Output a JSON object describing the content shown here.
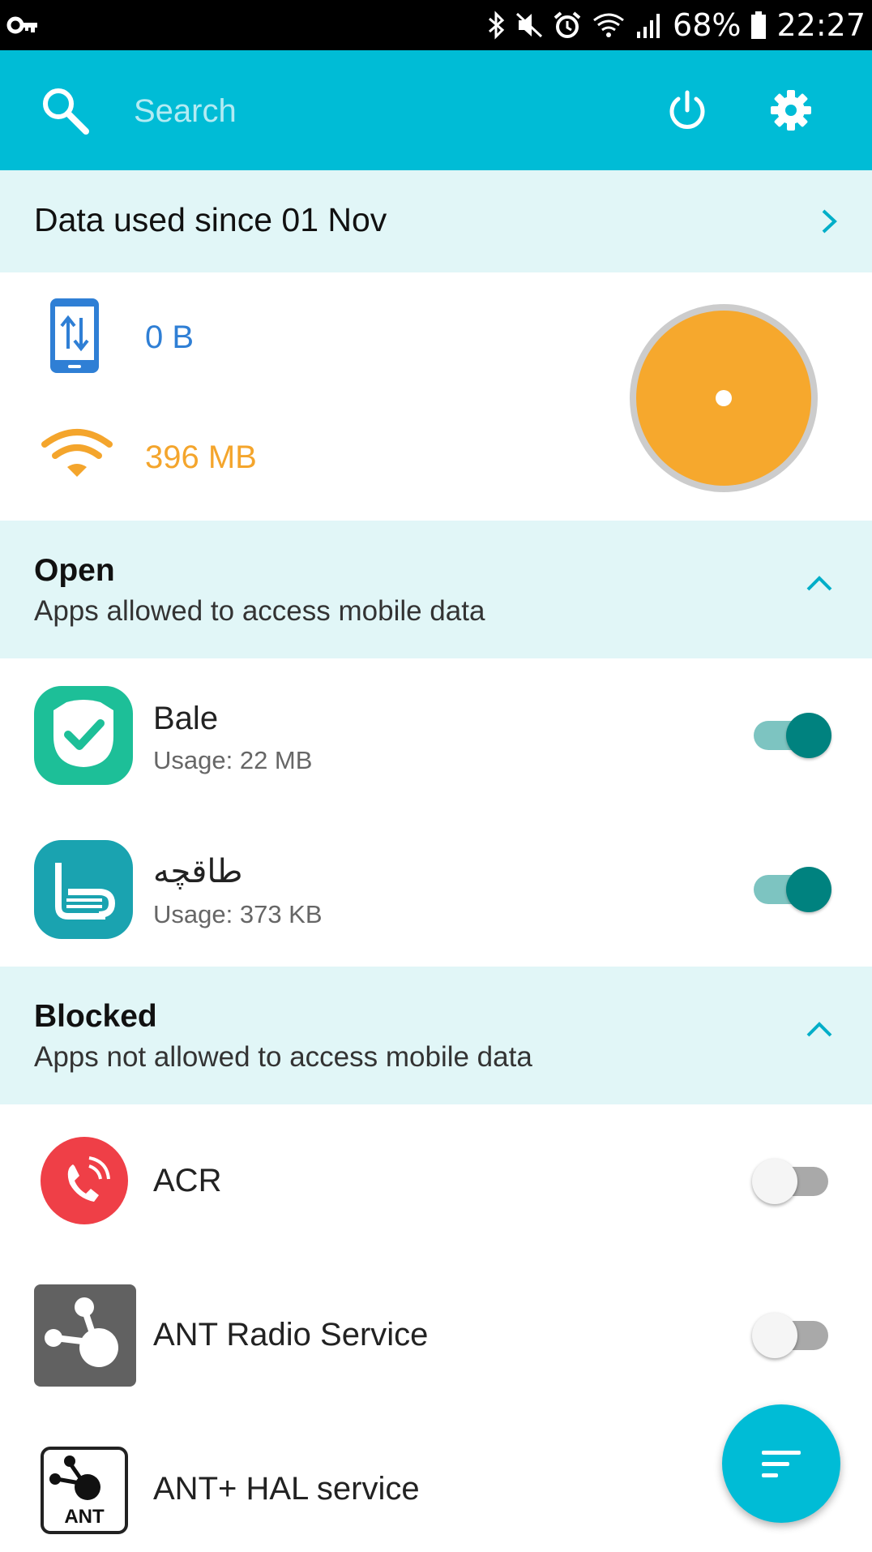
{
  "status_bar": {
    "battery": "68%",
    "time": "22:27",
    "icons": [
      "vpn-key-icon",
      "bluetooth-icon",
      "mute-icon",
      "alarm-icon",
      "wifi-icon",
      "signal-icon",
      "battery-icon"
    ]
  },
  "toolbar": {
    "search_placeholder": "Search",
    "icons": [
      "search-icon",
      "power-icon",
      "gear-icon"
    ],
    "accent": "#00bcd6"
  },
  "data_header": {
    "title": "Data used since 01 Nov"
  },
  "usage": {
    "mobile": "0 B",
    "wifi": "396 MB",
    "mobile_color": "#2f7fd5",
    "wifi_color": "#f4a52c"
  },
  "open": {
    "title": "Open",
    "subtitle": "Apps allowed to access mobile data",
    "apps": [
      {
        "name": "Bale",
        "usage": "Usage: 22 MB",
        "enabled": true
      },
      {
        "name": "طاقچه",
        "usage": "Usage: 373 KB",
        "enabled": true
      }
    ]
  },
  "blocked": {
    "title": "Blocked",
    "subtitle": "Apps not allowed to access mobile data",
    "apps": [
      {
        "name": "ACR",
        "enabled": false
      },
      {
        "name": "ANT Radio Service",
        "enabled": false
      },
      {
        "name": "ANT+ HAL service"
      }
    ],
    "ant_logo_text": "ANT"
  }
}
